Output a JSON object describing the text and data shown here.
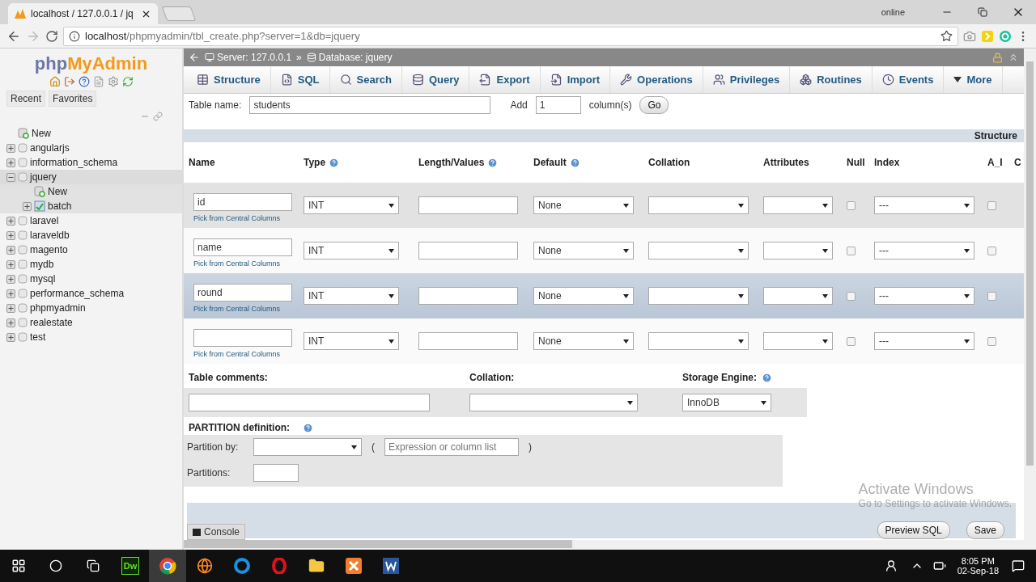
{
  "browser": {
    "tab_title": "localhost / 127.0.0.1 / jq",
    "url_host": "localhost",
    "url_path": "/phpmyadmin/tbl_create.php?server=1&db=jquery",
    "status": "online"
  },
  "sidebar": {
    "logo": [
      "php",
      "MyAdmin"
    ],
    "tabs": [
      "Recent",
      "Favorites"
    ],
    "tree": [
      {
        "label": "New",
        "kind": "new",
        "selected": false
      },
      {
        "label": "angularjs",
        "kind": "database",
        "expanded": false,
        "selected": false
      },
      {
        "label": "information_schema",
        "kind": "database",
        "expanded": false,
        "selected": false
      },
      {
        "label": "jquery",
        "kind": "database",
        "expanded": true,
        "selected": true,
        "children": [
          {
            "label": "New",
            "kind": "new",
            "selected": false
          },
          {
            "label": "batch",
            "kind": "table",
            "expanded": false,
            "selected": false
          }
        ]
      },
      {
        "label": "laravel",
        "kind": "database",
        "expanded": false,
        "selected": false
      },
      {
        "label": "laraveldb",
        "kind": "database",
        "expanded": false,
        "selected": false
      },
      {
        "label": "magento",
        "kind": "database",
        "expanded": false,
        "selected": false
      },
      {
        "label": "mydb",
        "kind": "database",
        "expanded": false,
        "selected": false
      },
      {
        "label": "mysql",
        "kind": "database",
        "expanded": false,
        "selected": false
      },
      {
        "label": "performance_schema",
        "kind": "database",
        "expanded": false,
        "selected": false
      },
      {
        "label": "phpmyadmin",
        "kind": "database",
        "expanded": false,
        "selected": false
      },
      {
        "label": "realestate",
        "kind": "database",
        "expanded": false,
        "selected": false
      },
      {
        "label": "test",
        "kind": "database",
        "expanded": false,
        "selected": false
      }
    ]
  },
  "breadcrumb": {
    "server": "Server: 127.0.0.1",
    "separator": "»",
    "database": "Database: jquery"
  },
  "tabs": [
    {
      "label": "Structure",
      "kind": "structure"
    },
    {
      "label": "SQL",
      "kind": "sql"
    },
    {
      "label": "Search",
      "kind": "search"
    },
    {
      "label": "Query",
      "kind": "query"
    },
    {
      "label": "Export",
      "kind": "export"
    },
    {
      "label": "Import",
      "kind": "import"
    },
    {
      "label": "Operations",
      "kind": "operations"
    },
    {
      "label": "Privileges",
      "kind": "privileges"
    },
    {
      "label": "Routines",
      "kind": "routines"
    },
    {
      "label": "Events",
      "kind": "events"
    },
    {
      "label": "More",
      "kind": "more"
    }
  ],
  "form": {
    "table_name_label": "Table name:",
    "table_name": "students",
    "add_label": "Add",
    "add_count": "1",
    "columns_label": "column(s)",
    "go": "Go"
  },
  "structure_title": "Structure",
  "columns": [
    {
      "label": "Name",
      "help": false
    },
    {
      "label": "Type",
      "help": true
    },
    {
      "label": "Length/Values",
      "help": true
    },
    {
      "label": "Default",
      "help": true
    },
    {
      "label": "Collation",
      "help": false
    },
    {
      "label": "Attributes",
      "help": false
    },
    {
      "label": "Null",
      "help": false
    },
    {
      "label": "Index",
      "help": false
    },
    {
      "label": "A_I",
      "help": false
    },
    {
      "label": "C",
      "help": false
    }
  ],
  "rows": [
    {
      "name": "id",
      "hint": "Pick from Central Columns",
      "type": "INT",
      "default": "None",
      "index": "---",
      "null": false,
      "ai": false,
      "selected": false
    },
    {
      "name": "name",
      "hint": "Pick from Central Columns",
      "type": "INT",
      "default": "None",
      "index": "---",
      "null": false,
      "ai": false,
      "selected": false
    },
    {
      "name": "round",
      "hint": "Pick from Central Columns",
      "type": "INT",
      "default": "None",
      "index": "---",
      "null": false,
      "ai": false,
      "selected": true
    },
    {
      "name": "",
      "hint": "Pick from Central Columns",
      "type": "INT",
      "default": "None",
      "index": "---",
      "null": false,
      "ai": false,
      "selected": false
    }
  ],
  "options": {
    "comments_label": "Table comments:",
    "collation_label": "Collation:",
    "engine_label": "Storage Engine:",
    "engine": "InnoDB"
  },
  "partition": {
    "title": "PARTITION definition:",
    "by_label": "Partition by:",
    "open": "(",
    "expression_placeholder": "Expression or column list",
    "close": ")",
    "partitions_label": "Partitions:"
  },
  "footer": {
    "console": "Console",
    "preview": "Preview SQL",
    "save": "Save"
  },
  "activation": {
    "title": "Activate Windows",
    "subtitle": "Go to Settings to activate Windows."
  },
  "taskbar": {
    "dw": "Dw",
    "time": "8:05 PM",
    "date": "02-Sep-18"
  }
}
